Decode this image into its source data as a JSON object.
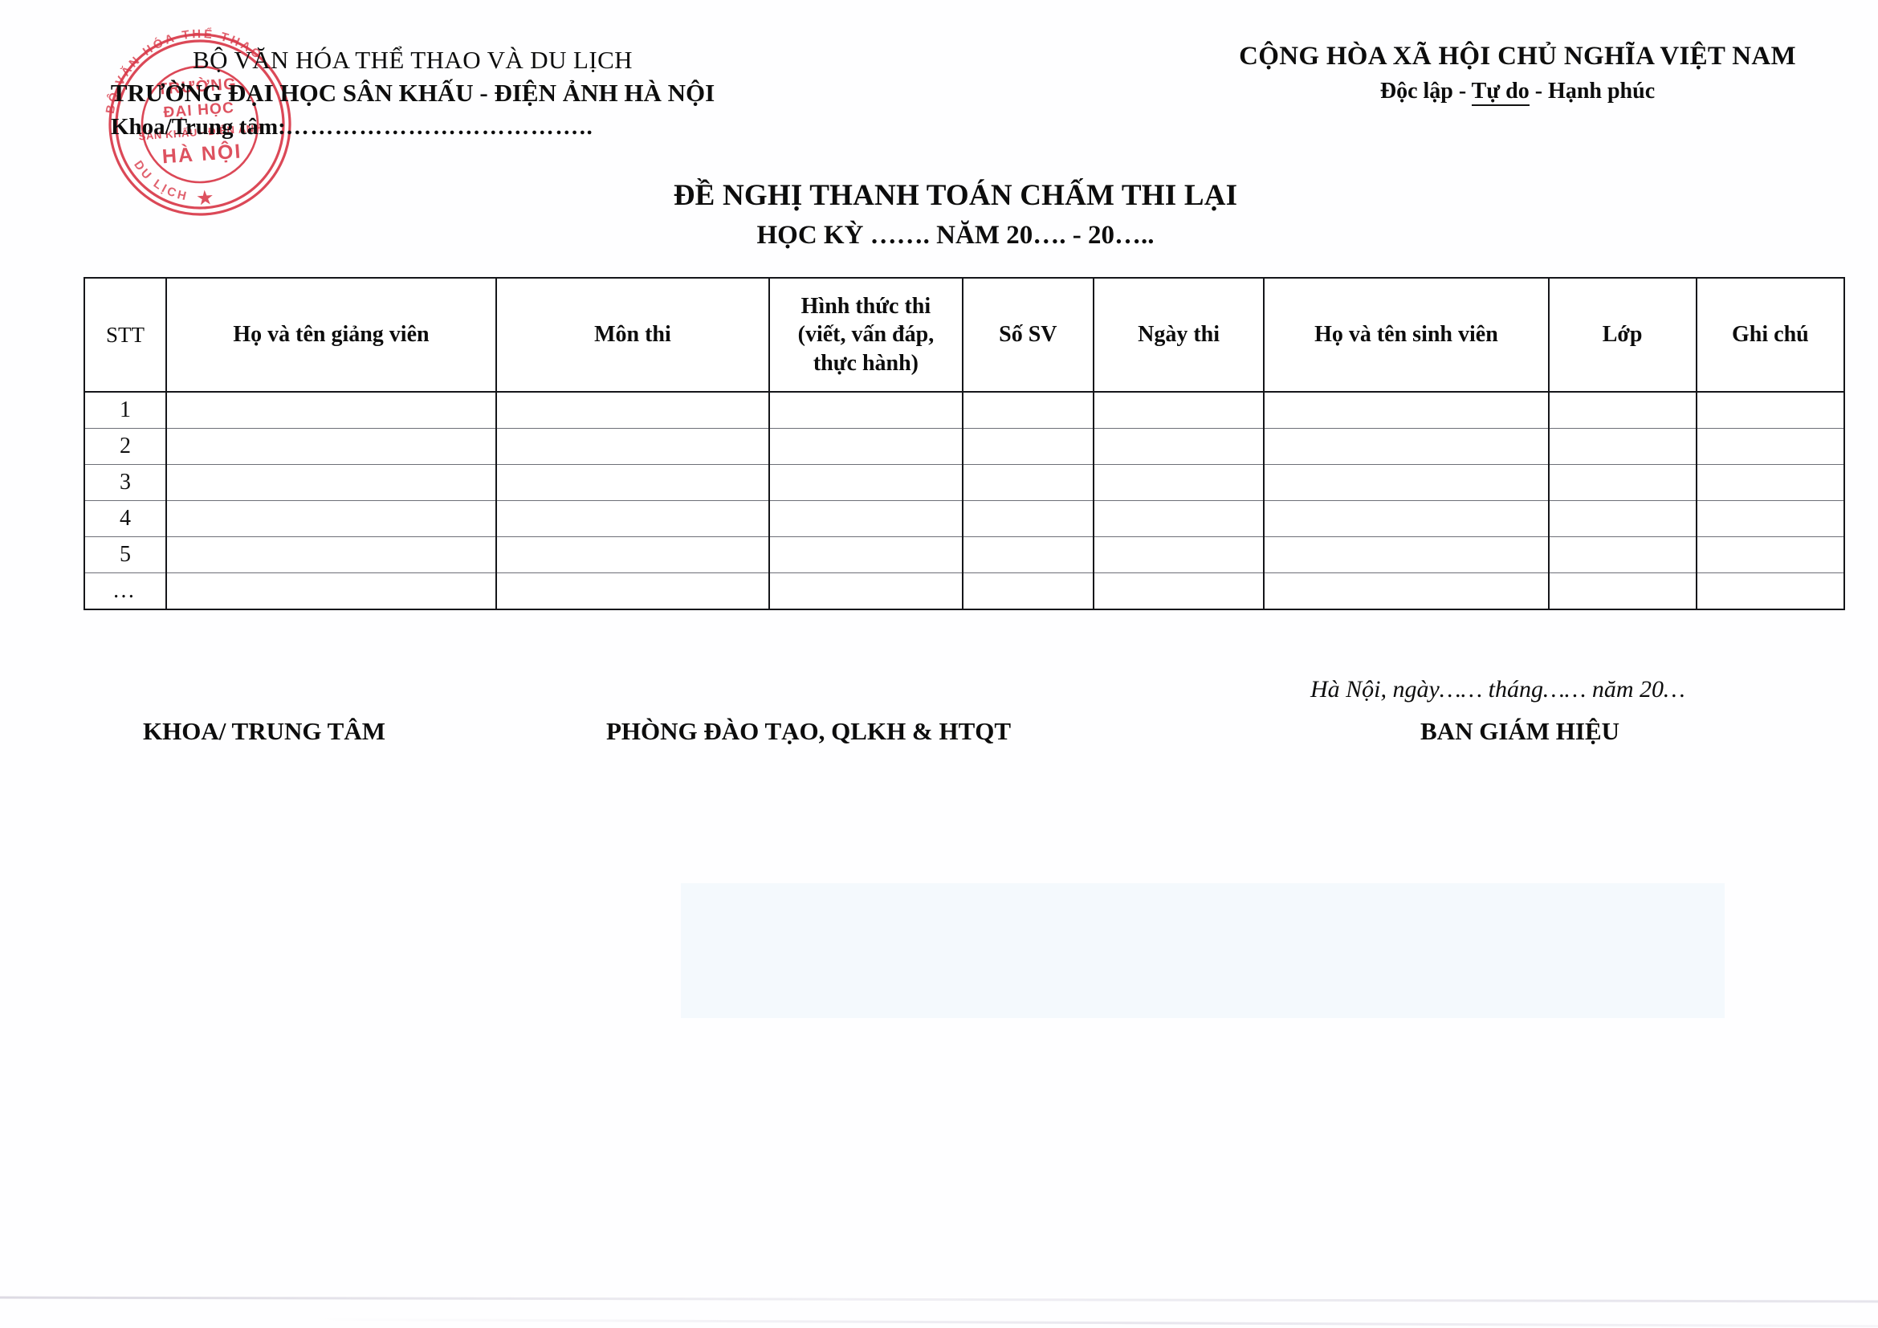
{
  "header": {
    "left": {
      "ministry": "BỘ VĂN HÓA THỂ THAO VÀ DU LỊCH",
      "university": "TRƯỜNG ĐẠI HỌC SÂN KHẤU - ĐIỆN ẢNH HÀ NỘI",
      "department_label": "Khoa/Trung tâm:",
      "department_dots": "………………………………..",
      "department_value": ""
    },
    "right": {
      "nation": "CỘNG HÒA XÃ HỘI CHỦ NGHĨA VIỆT NAM",
      "motto_before": "Độc lập - ",
      "motto_underlined": "Tự do",
      "motto_after": " - Hạnh phúc"
    }
  },
  "title": {
    "main": "ĐỀ NGHỊ THANH TOÁN CHẤM THI LẠI",
    "sub": "HỌC KỲ ……. NĂM 20…. - 20….."
  },
  "table": {
    "columns": [
      "STT",
      "Họ và tên giảng viên",
      "Môn thi",
      "Hình thức thi\n(viết, vấn đáp,\nthực hành)",
      "Số SV",
      "Ngày thi",
      "Họ và tên sinh viên",
      "Lớp",
      "Ghi chú"
    ],
    "columns_flat": {
      "stt": "STT",
      "lecturer": "Họ và tên giảng viên",
      "subject": "Môn thi",
      "exam_form_l1": "Hình thức thi",
      "exam_form_l2": "(viết, vấn đáp,",
      "exam_form_l3": "thực hành)",
      "student_count": "Số SV",
      "exam_date": "Ngày thi",
      "student_name": "Họ và tên sinh viên",
      "class": "Lớp",
      "note": "Ghi chú"
    },
    "rows": [
      {
        "stt": "1",
        "lecturer": "",
        "subject": "",
        "exam_form": "",
        "student_count": "",
        "exam_date": "",
        "student_name": "",
        "class": "",
        "note": ""
      },
      {
        "stt": "2",
        "lecturer": "",
        "subject": "",
        "exam_form": "",
        "student_count": "",
        "exam_date": "",
        "student_name": "",
        "class": "",
        "note": ""
      },
      {
        "stt": "3",
        "lecturer": "",
        "subject": "",
        "exam_form": "",
        "student_count": "",
        "exam_date": "",
        "student_name": "",
        "class": "",
        "note": ""
      },
      {
        "stt": "4",
        "lecturer": "",
        "subject": "",
        "exam_form": "",
        "student_count": "",
        "exam_date": "",
        "student_name": "",
        "class": "",
        "note": ""
      },
      {
        "stt": "5",
        "lecturer": "",
        "subject": "",
        "exam_form": "",
        "student_count": "",
        "exam_date": "",
        "student_name": "",
        "class": "",
        "note": ""
      },
      {
        "stt": "…",
        "lecturer": "",
        "subject": "",
        "exam_form": "",
        "student_count": "",
        "exam_date": "",
        "student_name": "",
        "class": "",
        "note": ""
      }
    ]
  },
  "footer": {
    "sign_khoa": "KHOA/ TRUNG TÂM",
    "sign_phong": "PHÒNG ĐÀO TẠO, QLKH & HTQT",
    "date_line": "Hà Nội, ngày…… tháng…… năm 20…",
    "sign_bgh": "BAN GIÁM HIỆU"
  },
  "seal": {
    "color": "#d62b3c",
    "outer_text": "BỘ VĂN HÓA THỂ THAO VÀ DU LỊCH",
    "inner_line1": "TRƯỜNG",
    "inner_line2": "ĐẠI HỌC",
    "inner_line3": "SÂN KHẤU - ĐIỆN ẢNH",
    "inner_line4": "HÀ NỘI",
    "star": "★"
  },
  "colors": {
    "ink": "#0d0d0d",
    "rule_light": "#6d6f77",
    "rule_dark": "#15161a",
    "seal_red": "#d62b3c",
    "blue_block": "#f4f9fd",
    "paper": "#fefeff"
  }
}
